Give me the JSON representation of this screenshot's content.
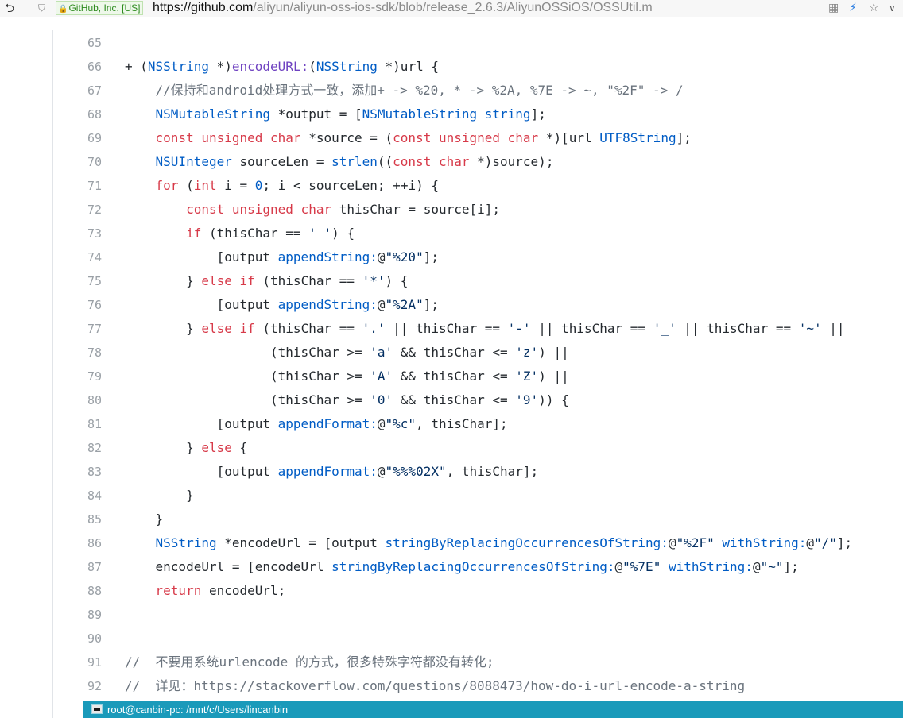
{
  "browser": {
    "back_glyph": "⮌",
    "shield_glyph": "⛉",
    "ev_lock": "🔒",
    "ev_label": "GitHub, Inc. [US]",
    "url_proto": "https://",
    "url_host": "github.com",
    "url_path": "/aliyun/aliyun-oss-ios-sdk/blob/release_2.6.3/AliyunOSSiOS/OSSUtil.m",
    "qr_glyph": "▦",
    "bolt_glyph": "⚡",
    "star_glyph": "☆",
    "caret_glyph": "∨",
    "icons": [
      "back-icon",
      "shield-icon",
      "lock-icon",
      "qr-code-icon",
      "bolt-icon",
      "star-icon",
      "chevron-down-icon"
    ]
  },
  "code": {
    "lines": [
      {
        "n": "65",
        "segs": [
          {
            "c": "",
            "t": ""
          }
        ]
      },
      {
        "n": "66",
        "segs": [
          {
            "c": "",
            "t": "+ ("
          },
          {
            "c": "t",
            "t": "NSString"
          },
          {
            "c": "",
            "t": " *)"
          },
          {
            "c": "f",
            "t": "encodeURL:"
          },
          {
            "c": "",
            "t": "("
          },
          {
            "c": "t",
            "t": "NSString"
          },
          {
            "c": "",
            "t": " *)url {"
          }
        ]
      },
      {
        "n": "67",
        "segs": [
          {
            "c": "c",
            "t": "    //保持和android处理方式一致，添加+ -> %20, * -> %2A, %7E -> ~, \"%2F\" -> /"
          }
        ]
      },
      {
        "n": "68",
        "segs": [
          {
            "c": "",
            "t": "    "
          },
          {
            "c": "t",
            "t": "NSMutableString"
          },
          {
            "c": "",
            "t": " *output = ["
          },
          {
            "c": "t",
            "t": "NSMutableString"
          },
          {
            "c": "",
            "t": " "
          },
          {
            "c": "t",
            "t": "string"
          },
          {
            "c": "",
            "t": "];"
          }
        ]
      },
      {
        "n": "69",
        "segs": [
          {
            "c": "",
            "t": "    "
          },
          {
            "c": "k",
            "t": "const unsigned char"
          },
          {
            "c": "",
            "t": " *source = ("
          },
          {
            "c": "k",
            "t": "const unsigned char"
          },
          {
            "c": "",
            "t": " *)[url "
          },
          {
            "c": "t",
            "t": "UTF8String"
          },
          {
            "c": "",
            "t": "];"
          }
        ]
      },
      {
        "n": "70",
        "segs": [
          {
            "c": "",
            "t": "    "
          },
          {
            "c": "t",
            "t": "NSUInteger"
          },
          {
            "c": "",
            "t": " sourceLen = "
          },
          {
            "c": "t",
            "t": "strlen"
          },
          {
            "c": "",
            "t": "(("
          },
          {
            "c": "k",
            "t": "const char"
          },
          {
            "c": "",
            "t": " *)source);"
          }
        ]
      },
      {
        "n": "71",
        "segs": [
          {
            "c": "",
            "t": "    "
          },
          {
            "c": "k",
            "t": "for"
          },
          {
            "c": "",
            "t": " ("
          },
          {
            "c": "k",
            "t": "int"
          },
          {
            "c": "",
            "t": " i = "
          },
          {
            "c": "t",
            "t": "0"
          },
          {
            "c": "",
            "t": "; i < sourceLen; ++i) {"
          }
        ]
      },
      {
        "n": "72",
        "segs": [
          {
            "c": "",
            "t": "        "
          },
          {
            "c": "k",
            "t": "const unsigned char"
          },
          {
            "c": "",
            "t": " thisChar = source[i];"
          }
        ]
      },
      {
        "n": "73",
        "segs": [
          {
            "c": "",
            "t": "        "
          },
          {
            "c": "k",
            "t": "if"
          },
          {
            "c": "",
            "t": " (thisChar == "
          },
          {
            "c": "s",
            "t": "' '"
          },
          {
            "c": "",
            "t": ") {"
          }
        ]
      },
      {
        "n": "74",
        "segs": [
          {
            "c": "",
            "t": "            [output "
          },
          {
            "c": "t",
            "t": "appendString:"
          },
          {
            "c": "",
            "t": "@"
          },
          {
            "c": "s",
            "t": "\"%20\""
          },
          {
            "c": "",
            "t": "];"
          }
        ]
      },
      {
        "n": "75",
        "segs": [
          {
            "c": "",
            "t": "        } "
          },
          {
            "c": "k",
            "t": "else if"
          },
          {
            "c": "",
            "t": " (thisChar == "
          },
          {
            "c": "s",
            "t": "'*'"
          },
          {
            "c": "",
            "t": ") {"
          }
        ]
      },
      {
        "n": "76",
        "segs": [
          {
            "c": "",
            "t": "            [output "
          },
          {
            "c": "t",
            "t": "appendString:"
          },
          {
            "c": "",
            "t": "@"
          },
          {
            "c": "s",
            "t": "\"%2A\""
          },
          {
            "c": "",
            "t": "];"
          }
        ]
      },
      {
        "n": "77",
        "segs": [
          {
            "c": "",
            "t": "        } "
          },
          {
            "c": "k",
            "t": "else if"
          },
          {
            "c": "",
            "t": " (thisChar == "
          },
          {
            "c": "s",
            "t": "'.'"
          },
          {
            "c": "",
            "t": " || thisChar == "
          },
          {
            "c": "s",
            "t": "'-'"
          },
          {
            "c": "",
            "t": " || thisChar == "
          },
          {
            "c": "s",
            "t": "'_'"
          },
          {
            "c": "",
            "t": " || thisChar == "
          },
          {
            "c": "s",
            "t": "'~'"
          },
          {
            "c": "",
            "t": " ||"
          }
        ]
      },
      {
        "n": "78",
        "segs": [
          {
            "c": "",
            "t": "                   (thisChar >= "
          },
          {
            "c": "s",
            "t": "'a'"
          },
          {
            "c": "",
            "t": " && thisChar <= "
          },
          {
            "c": "s",
            "t": "'z'"
          },
          {
            "c": "",
            "t": ") ||"
          }
        ]
      },
      {
        "n": "79",
        "segs": [
          {
            "c": "",
            "t": "                   (thisChar >= "
          },
          {
            "c": "s",
            "t": "'A'"
          },
          {
            "c": "",
            "t": " && thisChar <= "
          },
          {
            "c": "s",
            "t": "'Z'"
          },
          {
            "c": "",
            "t": ") ||"
          }
        ]
      },
      {
        "n": "80",
        "segs": [
          {
            "c": "",
            "t": "                   (thisChar >= "
          },
          {
            "c": "s",
            "t": "'0'"
          },
          {
            "c": "",
            "t": " && thisChar <= "
          },
          {
            "c": "s",
            "t": "'9'"
          },
          {
            "c": "",
            "t": ")) {"
          }
        ]
      },
      {
        "n": "81",
        "segs": [
          {
            "c": "",
            "t": "            [output "
          },
          {
            "c": "t",
            "t": "appendFormat:"
          },
          {
            "c": "",
            "t": "@"
          },
          {
            "c": "s",
            "t": "\"%c\""
          },
          {
            "c": "",
            "t": ", thisChar];"
          }
        ]
      },
      {
        "n": "82",
        "segs": [
          {
            "c": "",
            "t": "        } "
          },
          {
            "c": "k",
            "t": "else"
          },
          {
            "c": "",
            "t": " {"
          }
        ]
      },
      {
        "n": "83",
        "segs": [
          {
            "c": "",
            "t": "            [output "
          },
          {
            "c": "t",
            "t": "appendFormat:"
          },
          {
            "c": "",
            "t": "@"
          },
          {
            "c": "s",
            "t": "\"%%%02X\""
          },
          {
            "c": "",
            "t": ", thisChar];"
          }
        ]
      },
      {
        "n": "84",
        "segs": [
          {
            "c": "",
            "t": "        }"
          }
        ]
      },
      {
        "n": "85",
        "segs": [
          {
            "c": "",
            "t": "    }"
          }
        ]
      },
      {
        "n": "86",
        "segs": [
          {
            "c": "",
            "t": "    "
          },
          {
            "c": "t",
            "t": "NSString"
          },
          {
            "c": "",
            "t": " *encodeUrl = [output "
          },
          {
            "c": "t",
            "t": "stringByReplacingOccurrencesOfString:"
          },
          {
            "c": "",
            "t": "@"
          },
          {
            "c": "s",
            "t": "\"%2F\""
          },
          {
            "c": "",
            "t": " "
          },
          {
            "c": "t",
            "t": "withString:"
          },
          {
            "c": "",
            "t": "@"
          },
          {
            "c": "s",
            "t": "\"/\""
          },
          {
            "c": "",
            "t": "];"
          }
        ]
      },
      {
        "n": "87",
        "segs": [
          {
            "c": "",
            "t": "    encodeUrl = [encodeUrl "
          },
          {
            "c": "t",
            "t": "stringByReplacingOccurrencesOfString:"
          },
          {
            "c": "",
            "t": "@"
          },
          {
            "c": "s",
            "t": "\"%7E\""
          },
          {
            "c": "",
            "t": " "
          },
          {
            "c": "t",
            "t": "withString:"
          },
          {
            "c": "",
            "t": "@"
          },
          {
            "c": "s",
            "t": "\"~\""
          },
          {
            "c": "",
            "t": "];"
          }
        ]
      },
      {
        "n": "88",
        "segs": [
          {
            "c": "",
            "t": "    "
          },
          {
            "c": "k",
            "t": "return"
          },
          {
            "c": "",
            "t": " encodeUrl;"
          }
        ]
      },
      {
        "n": "89",
        "segs": [
          {
            "c": "",
            "t": ""
          }
        ]
      },
      {
        "n": "90",
        "segs": [
          {
            "c": "",
            "t": ""
          }
        ]
      },
      {
        "n": "91",
        "segs": [
          {
            "c": "c",
            "t": "//  不要用系统urlencode 的方式，很多特殊字符都没有转化;"
          }
        ]
      },
      {
        "n": "92",
        "segs": [
          {
            "c": "c",
            "t": "//  详见：https://stackoverflow.com/questions/8088473/how-do-i-url-encode-a-string"
          }
        ]
      }
    ]
  },
  "taskbar": {
    "title": "root@canbin-pc: /mnt/c/Users/lincanbin",
    "icon": "terminal-icon"
  }
}
